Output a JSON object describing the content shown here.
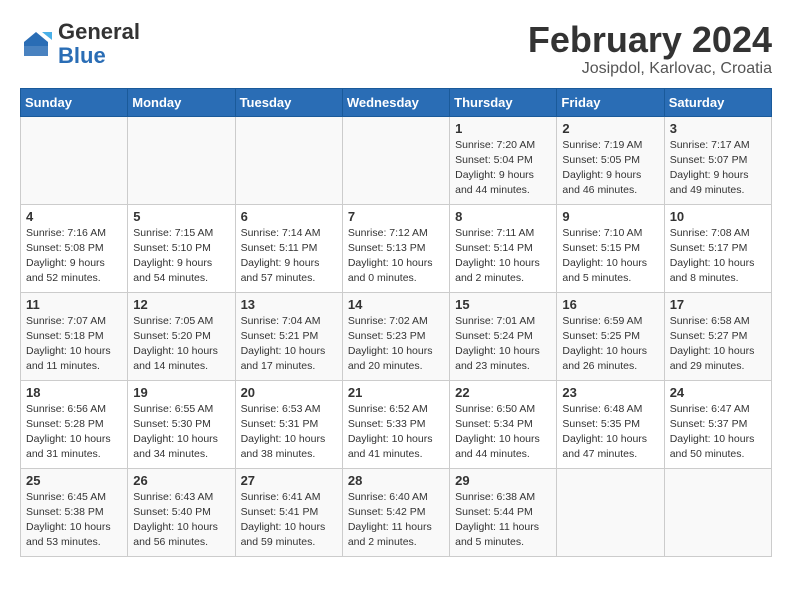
{
  "header": {
    "logo_general": "General",
    "logo_blue": "Blue",
    "month_year": "February 2024",
    "location": "Josipdol, Karlovac, Croatia"
  },
  "days_of_week": [
    "Sunday",
    "Monday",
    "Tuesday",
    "Wednesday",
    "Thursday",
    "Friday",
    "Saturday"
  ],
  "weeks": [
    [
      {
        "day": "",
        "info": ""
      },
      {
        "day": "",
        "info": ""
      },
      {
        "day": "",
        "info": ""
      },
      {
        "day": "",
        "info": ""
      },
      {
        "day": "1",
        "info": "Sunrise: 7:20 AM\nSunset: 5:04 PM\nDaylight: 9 hours\nand 44 minutes."
      },
      {
        "day": "2",
        "info": "Sunrise: 7:19 AM\nSunset: 5:05 PM\nDaylight: 9 hours\nand 46 minutes."
      },
      {
        "day": "3",
        "info": "Sunrise: 7:17 AM\nSunset: 5:07 PM\nDaylight: 9 hours\nand 49 minutes."
      }
    ],
    [
      {
        "day": "4",
        "info": "Sunrise: 7:16 AM\nSunset: 5:08 PM\nDaylight: 9 hours\nand 52 minutes."
      },
      {
        "day": "5",
        "info": "Sunrise: 7:15 AM\nSunset: 5:10 PM\nDaylight: 9 hours\nand 54 minutes."
      },
      {
        "day": "6",
        "info": "Sunrise: 7:14 AM\nSunset: 5:11 PM\nDaylight: 9 hours\nand 57 minutes."
      },
      {
        "day": "7",
        "info": "Sunrise: 7:12 AM\nSunset: 5:13 PM\nDaylight: 10 hours\nand 0 minutes."
      },
      {
        "day": "8",
        "info": "Sunrise: 7:11 AM\nSunset: 5:14 PM\nDaylight: 10 hours\nand 2 minutes."
      },
      {
        "day": "9",
        "info": "Sunrise: 7:10 AM\nSunset: 5:15 PM\nDaylight: 10 hours\nand 5 minutes."
      },
      {
        "day": "10",
        "info": "Sunrise: 7:08 AM\nSunset: 5:17 PM\nDaylight: 10 hours\nand 8 minutes."
      }
    ],
    [
      {
        "day": "11",
        "info": "Sunrise: 7:07 AM\nSunset: 5:18 PM\nDaylight: 10 hours\nand 11 minutes."
      },
      {
        "day": "12",
        "info": "Sunrise: 7:05 AM\nSunset: 5:20 PM\nDaylight: 10 hours\nand 14 minutes."
      },
      {
        "day": "13",
        "info": "Sunrise: 7:04 AM\nSunset: 5:21 PM\nDaylight: 10 hours\nand 17 minutes."
      },
      {
        "day": "14",
        "info": "Sunrise: 7:02 AM\nSunset: 5:23 PM\nDaylight: 10 hours\nand 20 minutes."
      },
      {
        "day": "15",
        "info": "Sunrise: 7:01 AM\nSunset: 5:24 PM\nDaylight: 10 hours\nand 23 minutes."
      },
      {
        "day": "16",
        "info": "Sunrise: 6:59 AM\nSunset: 5:25 PM\nDaylight: 10 hours\nand 26 minutes."
      },
      {
        "day": "17",
        "info": "Sunrise: 6:58 AM\nSunset: 5:27 PM\nDaylight: 10 hours\nand 29 minutes."
      }
    ],
    [
      {
        "day": "18",
        "info": "Sunrise: 6:56 AM\nSunset: 5:28 PM\nDaylight: 10 hours\nand 31 minutes."
      },
      {
        "day": "19",
        "info": "Sunrise: 6:55 AM\nSunset: 5:30 PM\nDaylight: 10 hours\nand 34 minutes."
      },
      {
        "day": "20",
        "info": "Sunrise: 6:53 AM\nSunset: 5:31 PM\nDaylight: 10 hours\nand 38 minutes."
      },
      {
        "day": "21",
        "info": "Sunrise: 6:52 AM\nSunset: 5:33 PM\nDaylight: 10 hours\nand 41 minutes."
      },
      {
        "day": "22",
        "info": "Sunrise: 6:50 AM\nSunset: 5:34 PM\nDaylight: 10 hours\nand 44 minutes."
      },
      {
        "day": "23",
        "info": "Sunrise: 6:48 AM\nSunset: 5:35 PM\nDaylight: 10 hours\nand 47 minutes."
      },
      {
        "day": "24",
        "info": "Sunrise: 6:47 AM\nSunset: 5:37 PM\nDaylight: 10 hours\nand 50 minutes."
      }
    ],
    [
      {
        "day": "25",
        "info": "Sunrise: 6:45 AM\nSunset: 5:38 PM\nDaylight: 10 hours\nand 53 minutes."
      },
      {
        "day": "26",
        "info": "Sunrise: 6:43 AM\nSunset: 5:40 PM\nDaylight: 10 hours\nand 56 minutes."
      },
      {
        "day": "27",
        "info": "Sunrise: 6:41 AM\nSunset: 5:41 PM\nDaylight: 10 hours\nand 59 minutes."
      },
      {
        "day": "28",
        "info": "Sunrise: 6:40 AM\nSunset: 5:42 PM\nDaylight: 11 hours\nand 2 minutes."
      },
      {
        "day": "29",
        "info": "Sunrise: 6:38 AM\nSunset: 5:44 PM\nDaylight: 11 hours\nand 5 minutes."
      },
      {
        "day": "",
        "info": ""
      },
      {
        "day": "",
        "info": ""
      }
    ]
  ]
}
